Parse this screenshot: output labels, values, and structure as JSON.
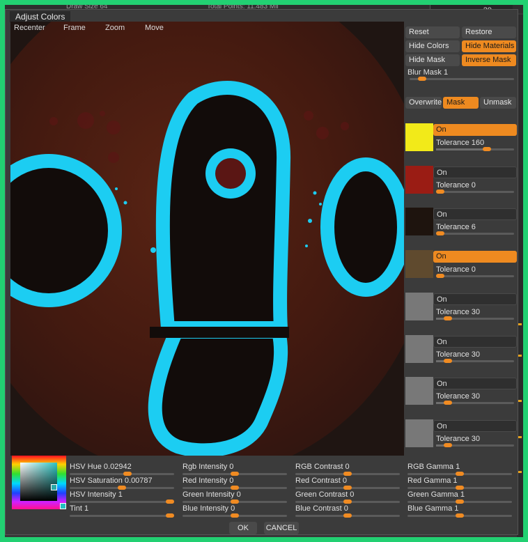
{
  "bgstrip": {
    "left_text": "Draw Size 64",
    "mid_text": "Total Points: 11.483 Mil",
    "thumb_badge": "29"
  },
  "dialog": {
    "title": "Adjust Colors"
  },
  "canvas": {
    "tools": [
      "Recenter",
      "Frame",
      "Zoom",
      "Move"
    ],
    "corners": {
      "tl": "⌃",
      "tr": "⌃"
    }
  },
  "right": {
    "reset": "Reset",
    "restore": "Restore",
    "hide_colors": "Hide Colors",
    "hide_materials": "Hide Materials",
    "hide_mask": "Hide Mask",
    "inverse_mask": "Inverse Mask",
    "blur_mask_label": "Blur Mask",
    "blur_mask_value": "1",
    "blur_mask_level": 0.1,
    "overwrite": "Overwrite",
    "mask": "Mask",
    "unmask": "Unmask"
  },
  "color_entries": [
    {
      "color": "#f2ea19",
      "on_label": "On",
      "on_active": true,
      "tol_label": "Tolerance",
      "tol_value": "160",
      "level": 0.62
    },
    {
      "color": "#9a1c14",
      "on_label": "On",
      "on_active": false,
      "tol_label": "Tolerance",
      "tol_value": "0",
      "level": 0.0
    },
    {
      "color": "#1e140e",
      "on_label": "On",
      "on_active": false,
      "tol_label": "Tolerance",
      "tol_value": "6",
      "level": 0.0
    },
    {
      "color": "#5f4a2e",
      "on_label": "On",
      "on_active": true,
      "tol_label": "Tolerance",
      "tol_value": "0",
      "level": 0.0
    },
    {
      "color": "#787878",
      "on_label": "On",
      "on_active": false,
      "tol_label": "Tolerance",
      "tol_value": "30",
      "level": 0.12
    },
    {
      "color": "#787878",
      "on_label": "On",
      "on_active": false,
      "tol_label": "Tolerance",
      "tol_value": "30",
      "level": 0.12
    },
    {
      "color": "#787878",
      "on_label": "On",
      "on_active": false,
      "tol_label": "Tolerance",
      "tol_value": "30",
      "level": 0.12
    },
    {
      "color": "#787878",
      "on_label": "On",
      "on_active": false,
      "tol_label": "Tolerance",
      "tol_value": "30",
      "level": 0.12
    }
  ],
  "adjust_sliders": [
    {
      "label": "HSV Hue",
      "value": "0.02942",
      "level": 0.55
    },
    {
      "label": "Rgb Intensity",
      "value": "0",
      "level": 0.5
    },
    {
      "label": "RGB Contrast",
      "value": "0",
      "level": 0.5
    },
    {
      "label": "RGB Gamma",
      "value": "1",
      "level": 0.5
    },
    {
      "label": "HSV Saturation",
      "value": "0.00787",
      "level": 0.5
    },
    {
      "label": "Red Intensity",
      "value": "0",
      "level": 0.5
    },
    {
      "label": "Red Contrast",
      "value": "0",
      "level": 0.5
    },
    {
      "label": "Red Gamma",
      "value": "1",
      "level": 0.5
    },
    {
      "label": "HSV Intensity",
      "value": "1",
      "level": 1.0
    },
    {
      "label": "Green Intensity",
      "value": "0",
      "level": 0.5
    },
    {
      "label": "Green Contrast",
      "value": "0",
      "level": 0.5
    },
    {
      "label": "Green Gamma",
      "value": "1",
      "level": 0.5
    },
    {
      "label": "Tint",
      "value": "1",
      "level": 1.0
    },
    {
      "label": "Blue Intensity",
      "value": "0",
      "level": 0.5
    },
    {
      "label": "Blue Contrast",
      "value": "0",
      "level": 0.5
    },
    {
      "label": "Blue Gamma",
      "value": "1",
      "level": 0.5
    }
  ],
  "footer": {
    "ok": "OK",
    "cancel": "CANCEL"
  },
  "colors": {
    "accent": "#ee8a20",
    "stroke": "#1ccdf2",
    "panel": "#3b3b3b"
  }
}
